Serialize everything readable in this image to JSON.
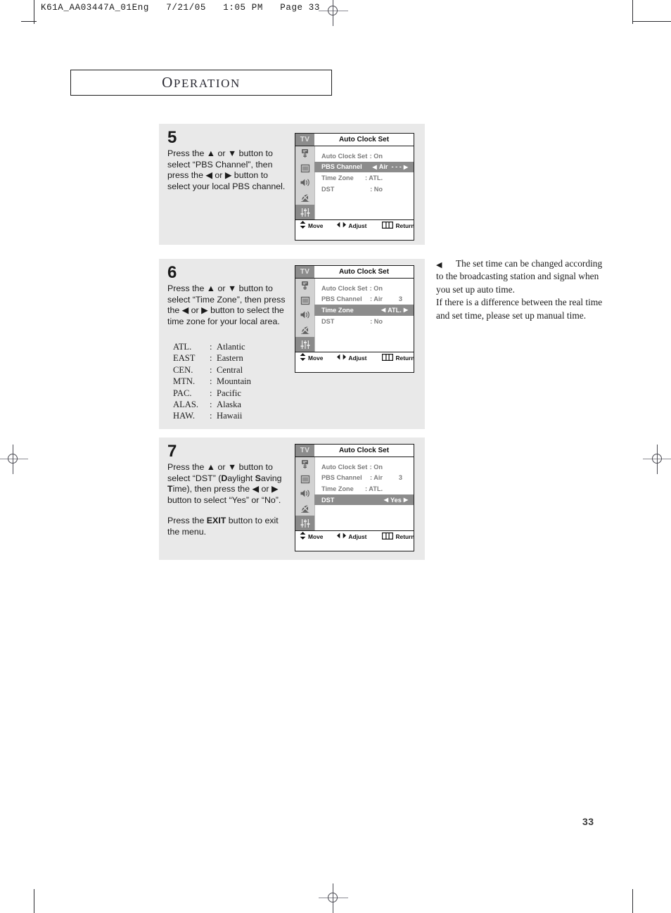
{
  "print_header": "K61A_AA03447A_01Eng   7/21/05   1:05 PM   Page 33",
  "section": {
    "title_first": "O",
    "title_rest": "PERATION"
  },
  "page_number": "33",
  "steps": [
    {
      "number": "5",
      "lines": [
        "Press the ▲ or ▼ button to select “PBS Channel”, then press the ◀ or ▶ button to select your local PBS channel."
      ]
    },
    {
      "number": "6",
      "lines": [
        "Press the ▲ or ▼ button to select “Time Zone”, then press the ◀ or ▶ button to select the time zone for your local area."
      ],
      "timezones": [
        {
          "abbr": "ATL.",
          "name": "Atlantic"
        },
        {
          "abbr": "EAST",
          "name": "Eastern"
        },
        {
          "abbr": "CEN.",
          "name": "Central"
        },
        {
          "abbr": "MTN.",
          "name": "Mountain"
        },
        {
          "abbr": "PAC.",
          "name": "Pacific"
        },
        {
          "abbr": "ALAS.",
          "name": "Alaska"
        },
        {
          "abbr": "HAW.",
          "name": "Hawaii"
        }
      ]
    },
    {
      "number": "7",
      "para1_a": "Press the ▲ or ▼ button to select “DST” (",
      "para1_d": "D",
      "para1_b": "aylight ",
      "para1_s": "S",
      "para1_c": "aving ",
      "para1_t": "T",
      "para1_e": "ime), then press the ◀ or ▶ button to select “Yes” or “No”.",
      "para2_a": "Press the ",
      "para2_exit": "EXIT",
      "para2_b": " button to exit the menu."
    }
  ],
  "osd": {
    "tv_tag": "TV",
    "title": "Auto Clock Set",
    "footer": {
      "move": "Move",
      "adjust": "Adjust",
      "return": "Return"
    },
    "rail_icons": [
      "antenna-icon",
      "picture-icon",
      "speaker-icon",
      "caption-off-icon",
      "setup-sliders-icon"
    ],
    "screens": [
      {
        "id": "osd-5",
        "active_rail": 4,
        "rows": [
          {
            "label": "Auto Clock Set",
            "value": ": On",
            "selected": false
          },
          {
            "label": "PBS Channel",
            "value": "Air",
            "channel": "- - -",
            "selected": true,
            "adjustable": true
          },
          {
            "label": "Time Zone",
            "value": ": ATL.",
            "selected": false
          },
          {
            "label": "DST",
            "value": ": No",
            "selected": false
          }
        ]
      },
      {
        "id": "osd-6",
        "active_rail": 4,
        "rows": [
          {
            "label": "Auto Clock Set",
            "value": ": On",
            "selected": false
          },
          {
            "label": "PBS Channel",
            "value": ": Air",
            "channel": "3",
            "selected": false
          },
          {
            "label": "Time Zone",
            "value": "ATL.",
            "selected": true,
            "adjustable": true
          },
          {
            "label": "DST",
            "value": ": No",
            "selected": false
          }
        ]
      },
      {
        "id": "osd-7",
        "active_rail": 4,
        "rows": [
          {
            "label": "Auto Clock Set",
            "value": ": On",
            "selected": false
          },
          {
            "label": "PBS Channel",
            "value": ": Air",
            "channel": "3",
            "selected": false
          },
          {
            "label": "Time Zone",
            "value": ": ATL.",
            "selected": false
          },
          {
            "label": "DST",
            "value": "Yes",
            "selected": true,
            "adjustable": true
          }
        ]
      }
    ]
  },
  "note": {
    "marker": "◀",
    "para1": "The set time can be changed according to the broadcasting station and signal when you set up auto time.",
    "para2": "If there is a difference between the real time and set time, please set up manual time."
  },
  "colors": {
    "block_bg": "#e9e9e9",
    "osd_rail": "#d2d2d2",
    "osd_highlight": "#8c8c8c",
    "osd_text": "#7c7c7c"
  }
}
